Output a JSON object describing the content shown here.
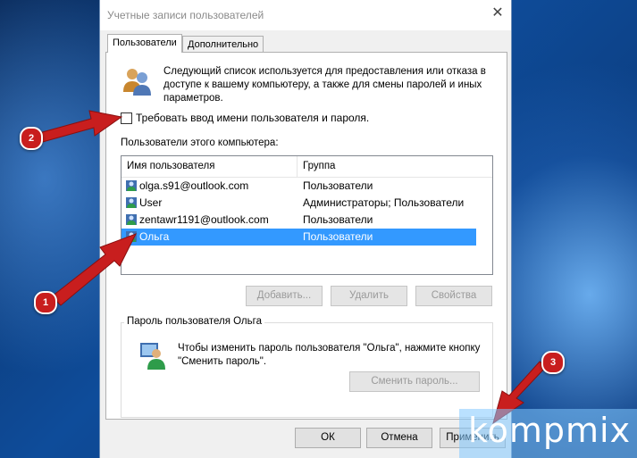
{
  "window": {
    "title": "Учетные записи пользователей",
    "close_glyph": "✕"
  },
  "tabs": [
    {
      "label": "Пользователи",
      "active": true
    },
    {
      "label": "Дополнительно",
      "active": false
    }
  ],
  "info_text": "Следующий список используется для предоставления или отказа в доступе к вашему компьютеру, а также для смены паролей и иных параметров.",
  "require_login": {
    "label": "Требовать ввод имени пользователя и пароля.",
    "checked": false
  },
  "users_section_label": "Пользователи этого компьютера:",
  "user_list": {
    "columns": [
      "Имя пользователя",
      "Группа"
    ],
    "rows": [
      {
        "name": "olga.s91@outlook.com",
        "group": "Пользователи",
        "selected": false
      },
      {
        "name": "User",
        "group": "Администраторы; Пользователи",
        "selected": false
      },
      {
        "name": "zentawr1191@outlook.com",
        "group": "Пользователи",
        "selected": false
      },
      {
        "name": "Ольга",
        "group": "Пользователи",
        "selected": true
      }
    ]
  },
  "list_buttons": {
    "add": "Добавить...",
    "remove": "Удалить",
    "properties": "Свойства"
  },
  "password_group": {
    "title": "Пароль пользователя Ольга",
    "text": "Чтобы изменить пароль пользователя \"Ольга\", нажмите кнопку \"Сменить пароль\".",
    "change_button": "Сменить пароль..."
  },
  "footer_buttons": {
    "ok": "ОК",
    "cancel": "Отмена",
    "apply": "Применить"
  },
  "annotations": [
    {
      "number": "1"
    },
    {
      "number": "2"
    },
    {
      "number": "3"
    }
  ],
  "watermark": "kompmix",
  "colors": {
    "selection": "#3399ff",
    "annotation_red": "#c81e1e",
    "desktop_blue": "#0e4c9a"
  }
}
